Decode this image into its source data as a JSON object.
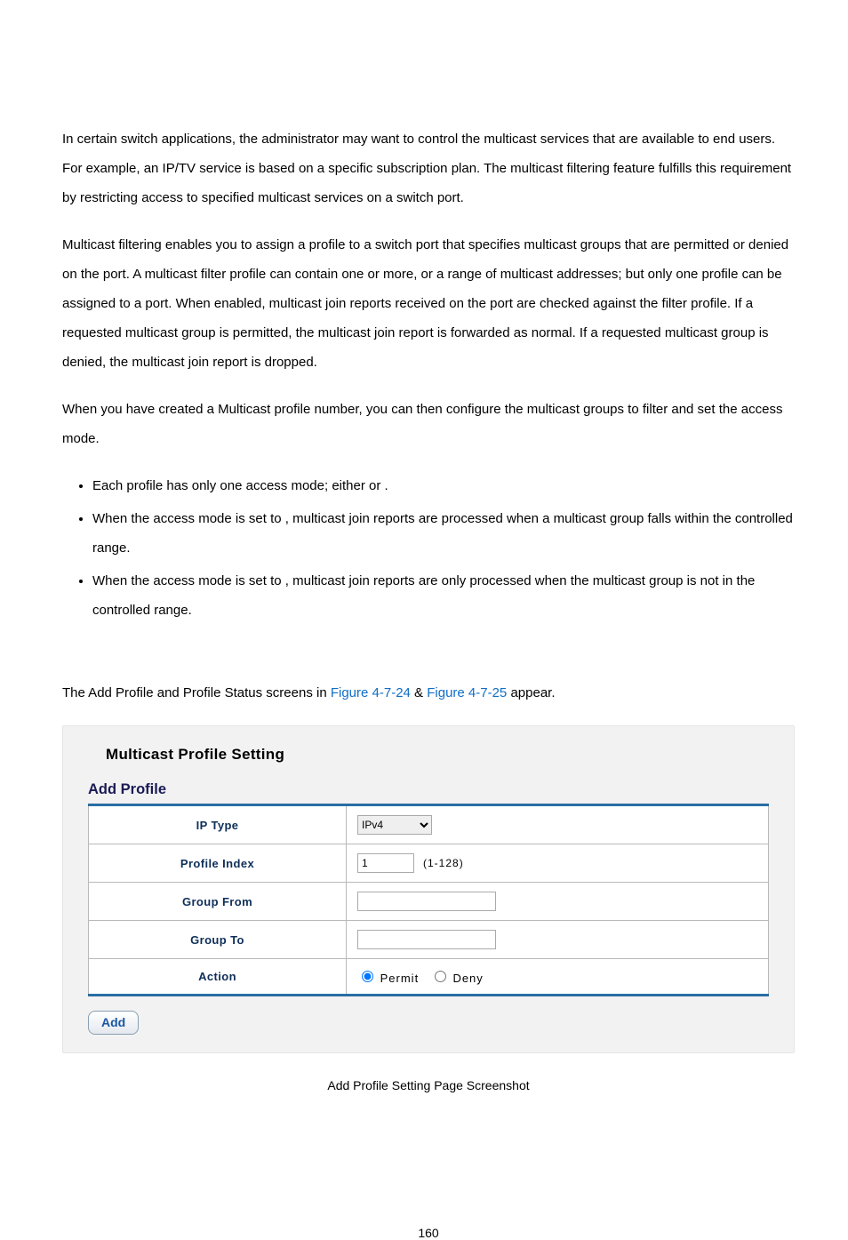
{
  "paragraphs": {
    "p1": "In certain switch applications, the administrator may want to control the multicast services that are available to end users. For example, an IP/TV service is based on a specific subscription plan. The multicast filtering feature fulfills this requirement by restricting access to specified multicast services on a switch port.",
    "p2": "Multicast filtering enables you to assign a profile to a switch port that specifies multicast groups that are permitted or denied on the port. A multicast filter profile can contain one or more, or a range of multicast addresses; but only one profile can be assigned to a port. When enabled, multicast join reports received on the port are checked against the filter profile. If a requested multicast group is permitted, the multicast join report is forwarded as normal. If a requested multicast group is denied, the multicast join report is dropped.",
    "p3": "When you have created a Multicast profile number, you can then configure the multicast groups to filter and set the access mode.",
    "b1a": "Each profile has only one access mode; either ",
    "b1b": " or ",
    "b1c": ".",
    "b2a": "When the access mode is set to ",
    "b2b": ", multicast join reports are processed when a multicast group falls within the controlled range.",
    "b3a": "When the access mode is set to ",
    "b3b": ", multicast join reports are only processed when the multicast group is not in the controlled range.",
    "intro_a": "The Add Profile and Profile Status screens in ",
    "intro_link1": "Figure 4-7-24",
    "intro_amp": " & ",
    "intro_link2": "Figure 4-7-25",
    "intro_b": " appear."
  },
  "shot": {
    "title": "Multicast Profile Setting",
    "subtitle": "Add Profile",
    "rows": {
      "ip_label": "IP Type",
      "ip_value": "IPv4",
      "pi_label": "Profile Index",
      "pi_value": "1",
      "pi_hint": "(1-128)",
      "gf_label": "Group From",
      "gt_label": "Group To",
      "act_label": "Action",
      "act_permit": "Permit",
      "act_deny": "Deny"
    },
    "add": "Add"
  },
  "caption": "Add Profile Setting Page Screenshot",
  "pagenum": "160"
}
